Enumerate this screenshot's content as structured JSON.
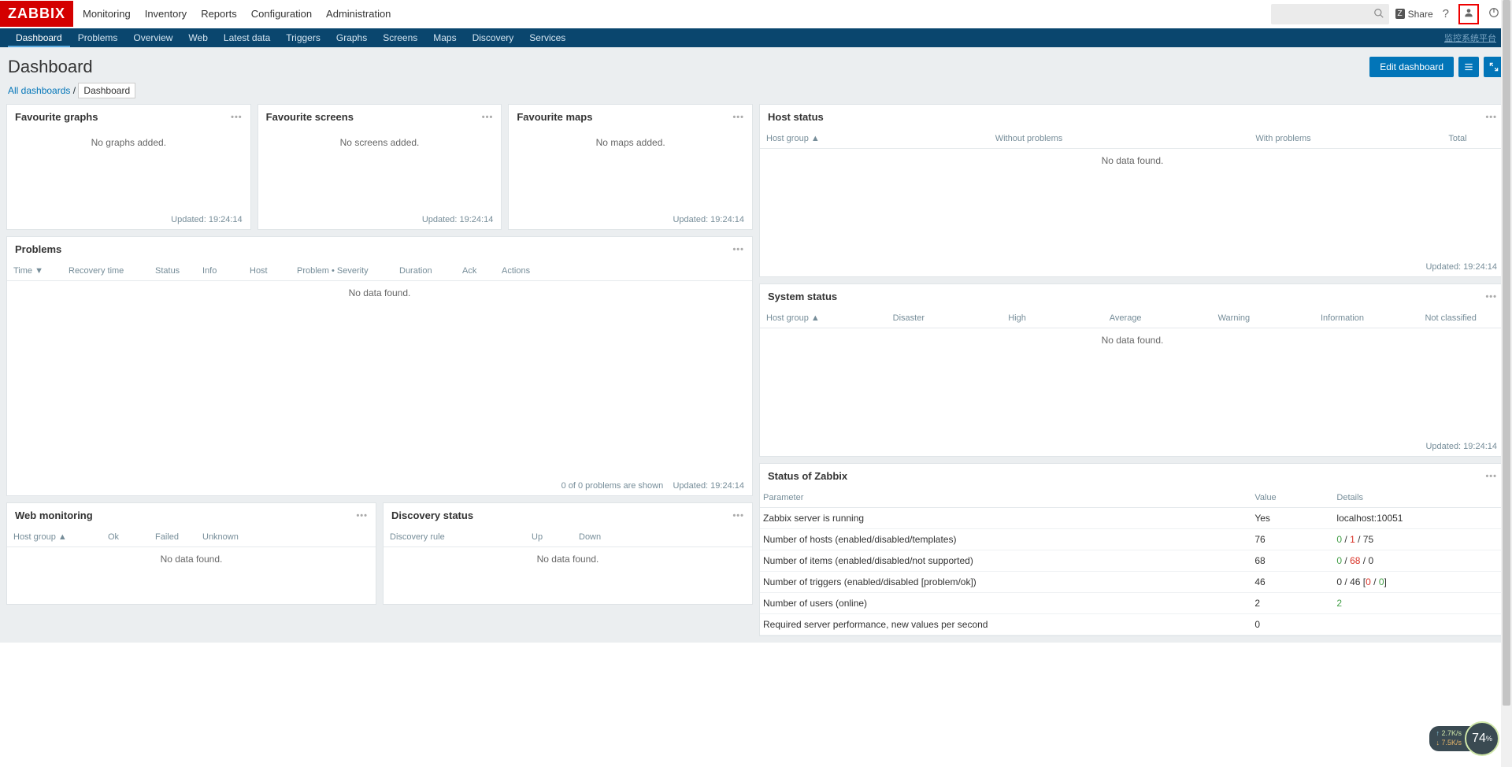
{
  "brand": "ZABBIX",
  "topnav": [
    "Monitoring",
    "Inventory",
    "Reports",
    "Configuration",
    "Administration"
  ],
  "share_label": "Share",
  "subnav": [
    "Dashboard",
    "Problems",
    "Overview",
    "Web",
    "Latest data",
    "Triggers",
    "Graphs",
    "Screens",
    "Maps",
    "Discovery",
    "Services"
  ],
  "subnav_right": "监控系统平台",
  "page_title": "Dashboard",
  "edit_btn": "Edit dashboard",
  "breadcrumb": {
    "all": "All dashboards",
    "sep": "/",
    "current": "Dashboard"
  },
  "fav_graphs": {
    "title": "Favourite graphs",
    "empty": "No graphs added.",
    "updated": "Updated: 19:24:14"
  },
  "fav_screens": {
    "title": "Favourite screens",
    "empty": "No screens added.",
    "updated": "Updated: 19:24:14"
  },
  "fav_maps": {
    "title": "Favourite maps",
    "empty": "No maps added.",
    "updated": "Updated: 19:24:14"
  },
  "problems": {
    "title": "Problems",
    "cols": [
      "Time ▼",
      "Recovery time",
      "Status",
      "Info",
      "Host",
      "Problem • Severity",
      "Duration",
      "Ack",
      "Actions"
    ],
    "nodata": "No data found.",
    "footer_count": "0 of 0 problems are shown",
    "updated": "Updated: 19:24:14"
  },
  "webmon": {
    "title": "Web monitoring",
    "cols": [
      "Host group ▲",
      "Ok",
      "Failed",
      "Unknown"
    ],
    "nodata": "No data found."
  },
  "discovery": {
    "title": "Discovery status",
    "cols": [
      "Discovery rule",
      "Up",
      "Down"
    ],
    "nodata": "No data found."
  },
  "hoststatus": {
    "title": "Host status",
    "cols": [
      "Host group ▲",
      "Without problems",
      "With problems",
      "Total"
    ],
    "nodata": "No data found.",
    "updated": "Updated: 19:24:14"
  },
  "sysstatus": {
    "title": "System status",
    "cols": [
      "Host group ▲",
      "Disaster",
      "High",
      "Average",
      "Warning",
      "Information",
      "Not classified"
    ],
    "nodata": "No data found.",
    "updated": "Updated: 19:24:14"
  },
  "zabbixstatus": {
    "title": "Status of Zabbix",
    "cols": [
      "Parameter",
      "Value",
      "Details"
    ],
    "rows": [
      {
        "param": "Zabbix server is running",
        "value": "Yes",
        "value_class": "green",
        "details_html": "localhost:10051"
      },
      {
        "param": "Number of hosts (enabled/disabled/templates)",
        "value": "76",
        "details_html": "<span class='green'>0</span> / <span class='red'>1</span> / 75"
      },
      {
        "param": "Number of items (enabled/disabled/not supported)",
        "value": "68",
        "details_html": "<span class='green'>0</span> / <span class='red'>68</span> / 0"
      },
      {
        "param": "Number of triggers (enabled/disabled [problem/ok])",
        "value": "46",
        "details_html": "0 / 46 [<span class='red'>0</span> / <span class='green'>0</span>]"
      },
      {
        "param": "Number of users (online)",
        "value": "2",
        "details_html": "<span class='green'>2</span>"
      },
      {
        "param": "Required server performance, new values per second",
        "value": "0",
        "details_html": ""
      }
    ]
  },
  "netwidget": {
    "up": "2.7K/s",
    "down": "7.5K/s",
    "pct": "74",
    "pct_suffix": "%"
  }
}
